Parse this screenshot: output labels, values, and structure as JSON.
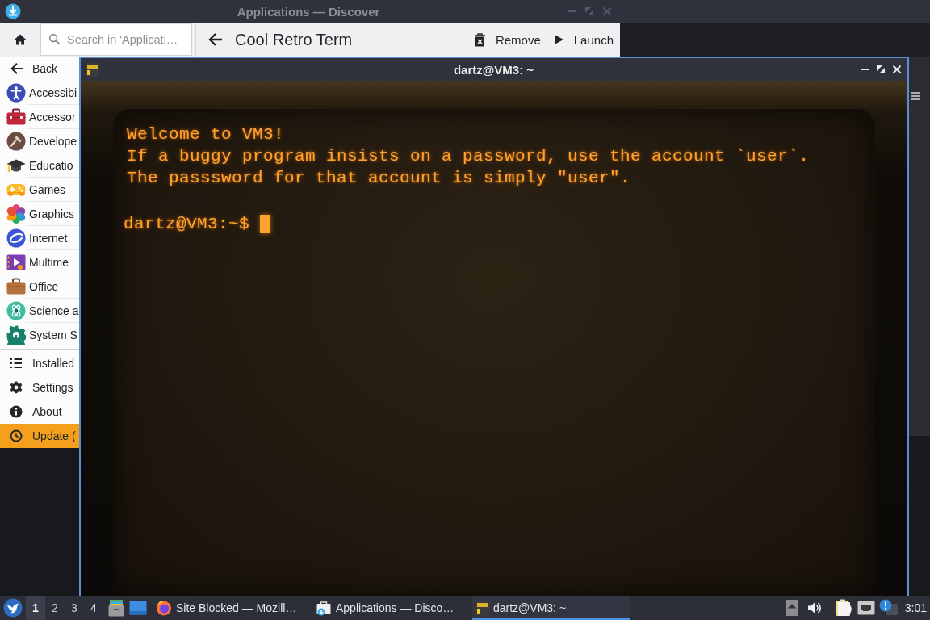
{
  "discover_window": {
    "title": "Applications — Discover",
    "search": {
      "placeholder": "Search in 'Applicati…"
    },
    "page_title": "Cool Retro Term",
    "buttons": [
      "Remove",
      "Launch"
    ],
    "sidebar": {
      "back": "Back",
      "categories": [
        "Accessibi",
        "Accessor",
        "Develope",
        "Educatio",
        "Games",
        "Graphics",
        "Internet",
        "Multime",
        "Office",
        "Science a",
        "System S"
      ],
      "actions": [
        "Installed",
        "Settings",
        "About"
      ],
      "update": "Update ("
    }
  },
  "terminal_window": {
    "title": "dartz@VM3: ~",
    "lines": [
      "Welcome to VM3!",
      "If a buggy program insists on a password, use the account `user`.",
      "The passsword for that account is simply \"user\"."
    ],
    "prompt": "dartz@VM3:~$"
  },
  "taskbar": {
    "workspaces": [
      {
        "label": "1",
        "selected": true
      },
      {
        "label": "2",
        "selected": false
      },
      {
        "label": "3",
        "selected": false
      },
      {
        "label": "4",
        "selected": false
      }
    ],
    "tasks": [
      {
        "label": "Site Blocked — Mozill…",
        "selected": false
      },
      {
        "label": "Applications — Disco…",
        "selected": false
      },
      {
        "label": "dartz@VM3: ~",
        "selected": true
      }
    ],
    "clock": "3:01"
  }
}
